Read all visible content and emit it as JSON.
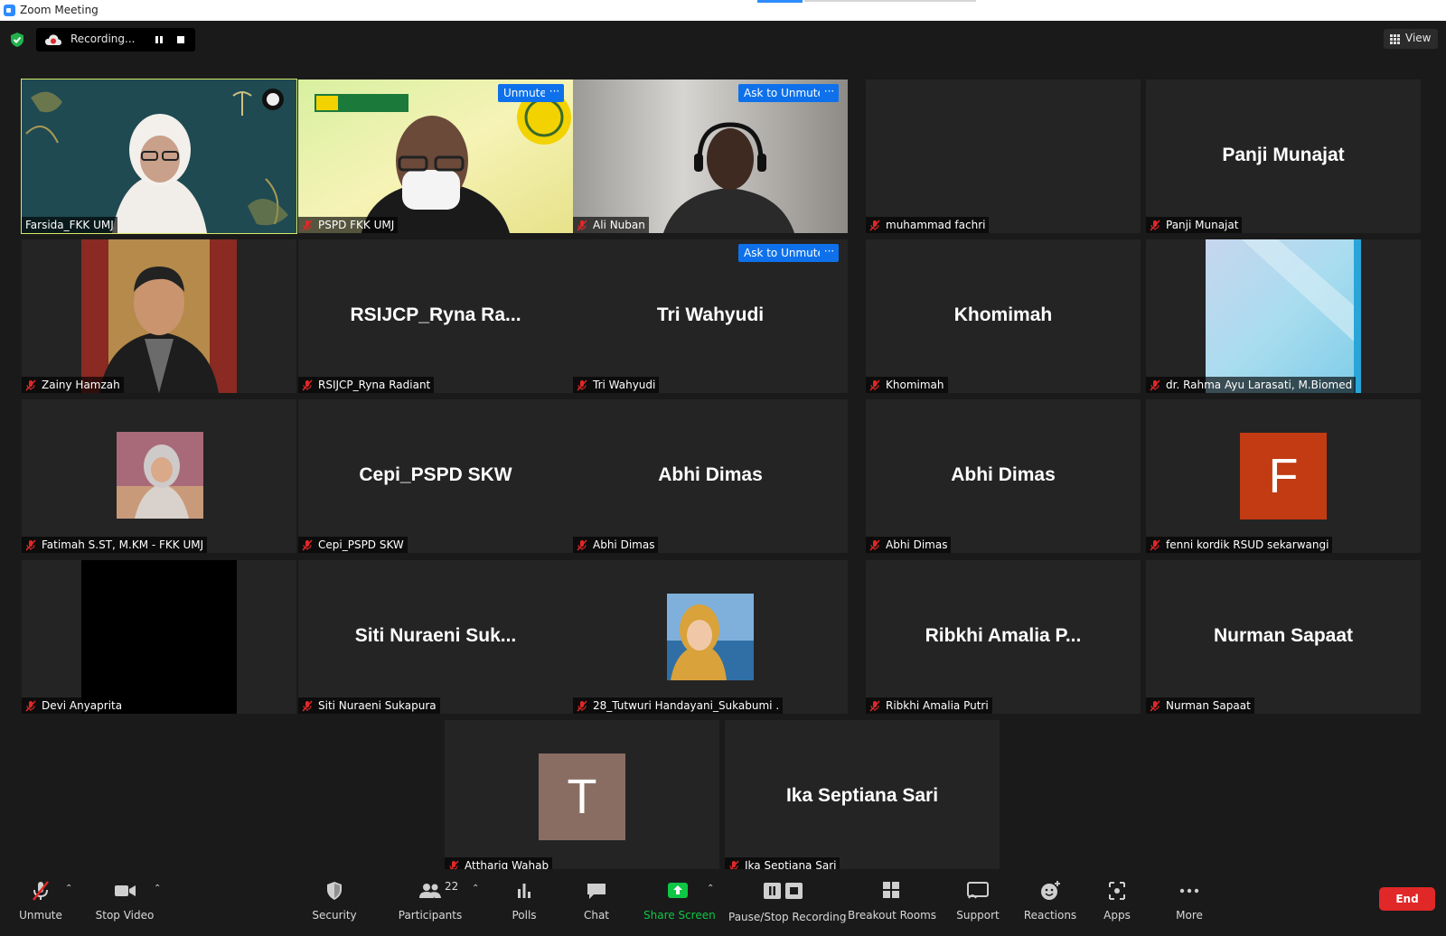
{
  "window": {
    "title": "Zoom Meeting"
  },
  "recording": {
    "label": "Recording..."
  },
  "view": {
    "label": "View"
  },
  "tiles": [
    {
      "name": "Farsida_FKK UMJ",
      "display": ""
    },
    {
      "name": "PSPD FKK UMJ",
      "display": "",
      "button": "Unmute",
      "logo_text_1": "THE FACULTY",
      "logo_text_2": "OF MEDICINE AND HEALTH"
    },
    {
      "name": "Ali Nuban",
      "display": "",
      "button": "Ask to Unmute"
    },
    {
      "name": "muhammad fachri",
      "display": ""
    },
    {
      "name": "Panji Munajat",
      "display": "Panji Munajat"
    },
    {
      "name": "Zainy Hamzah",
      "display": ""
    },
    {
      "name": "RSIJCP_Ryna Radiant",
      "display": "RSIJCP_Ryna  Ra..."
    },
    {
      "name": "Tri Wahyudi",
      "display": "Tri Wahyudi",
      "button": "Ask to Unmute"
    },
    {
      "name": "Khomimah",
      "display": "Khomimah"
    },
    {
      "name": "dr. Rahma Ayu Larasati, M.Biomed",
      "display": ""
    },
    {
      "name": "Fatimah S.ST, M.KM - FKK UMJ",
      "display": ""
    },
    {
      "name": "Cepi_PSPD SKW",
      "display": "Cepi_PSPD SKW"
    },
    {
      "name": "Abhi Dimas",
      "display": "Abhi Dimas"
    },
    {
      "name": "Abhi Dimas",
      "display": "Abhi Dimas"
    },
    {
      "name": "fenni kordik RSUD sekarwangi",
      "display": "",
      "avatar_letter": "F",
      "avatar_color": "#c23b13"
    },
    {
      "name": "Devi Anyaprita",
      "display": ""
    },
    {
      "name": "Siti Nuraeni Sukapura",
      "display": "Siti  Nuraeni  Suk..."
    },
    {
      "name": "28_Tutwuri Handayani_Sukabumi .",
      "display": ""
    },
    {
      "name": "Ribkhi Amalia Putri",
      "display": "Ribkhi  Amalia  P..."
    },
    {
      "name": "Nurman Sapaat",
      "display": "Nurman Sapaat"
    },
    {
      "name": "Atthariq Wahab",
      "display": "",
      "avatar_letter": "T",
      "avatar_color": "#8a6d62"
    },
    {
      "name": "Ika Septiana Sari",
      "display": "Ika Septiana Sari"
    }
  ],
  "toolbar": {
    "unmute": "Unmute",
    "stop_video": "Stop Video",
    "security": "Security",
    "participants": "Participants",
    "participants_count": "22",
    "polls": "Polls",
    "chat": "Chat",
    "share_screen": "Share Screen",
    "pause_stop_recording": "Pause/Stop Recording",
    "breakout_rooms": "Breakout Rooms",
    "support": "Support",
    "reactions": "Reactions",
    "apps": "Apps",
    "more": "More",
    "end": "End"
  },
  "colors": {
    "accent": "#0e71eb",
    "active_speaker": "#d7e866",
    "share_green": "#0ec745",
    "end_red": "#e02828"
  }
}
